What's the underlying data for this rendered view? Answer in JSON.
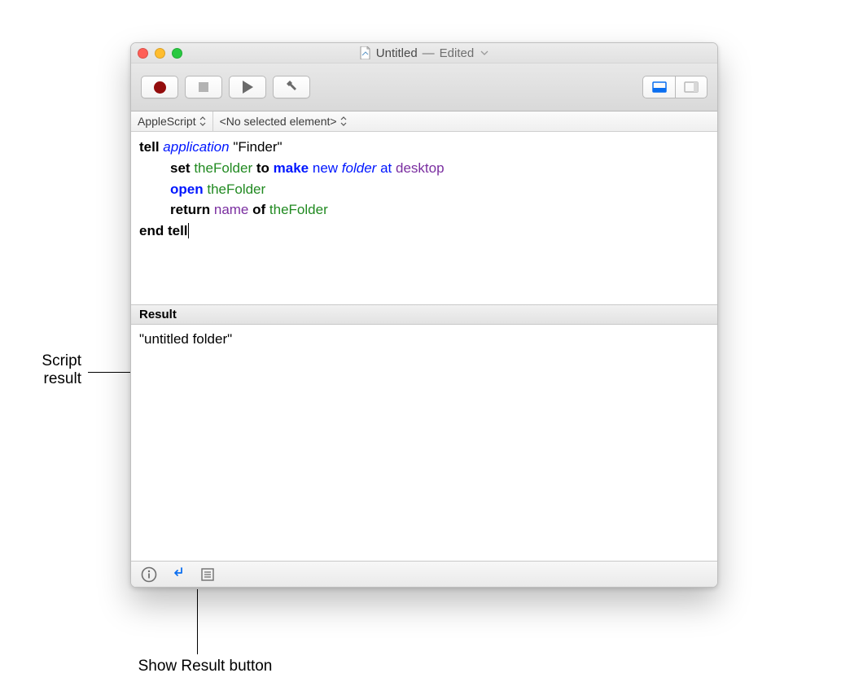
{
  "window": {
    "filename": "Untitled",
    "status": "Edited"
  },
  "navbar": {
    "language": "AppleScript",
    "element": "<No selected element>"
  },
  "code": {
    "l1": {
      "tell": "tell",
      "application": "application",
      "target": "\"Finder\""
    },
    "l2": {
      "set": "set",
      "var": "theFolder",
      "to": "to",
      "make": "make",
      "new": "new",
      "folder": "folder",
      "at": "at",
      "desktop": "desktop"
    },
    "l3": {
      "open": "open",
      "var": "theFolder"
    },
    "l4": {
      "return": "return",
      "name": "name",
      "of": "of",
      "var": "theFolder"
    },
    "l5": {
      "end": "end",
      "tell": "tell"
    }
  },
  "result": {
    "header": "Result",
    "value": "\"untitled folder\""
  },
  "annotations": {
    "script_result_l1": "Script",
    "script_result_l2": "result",
    "show_result_button": "Show Result button"
  }
}
